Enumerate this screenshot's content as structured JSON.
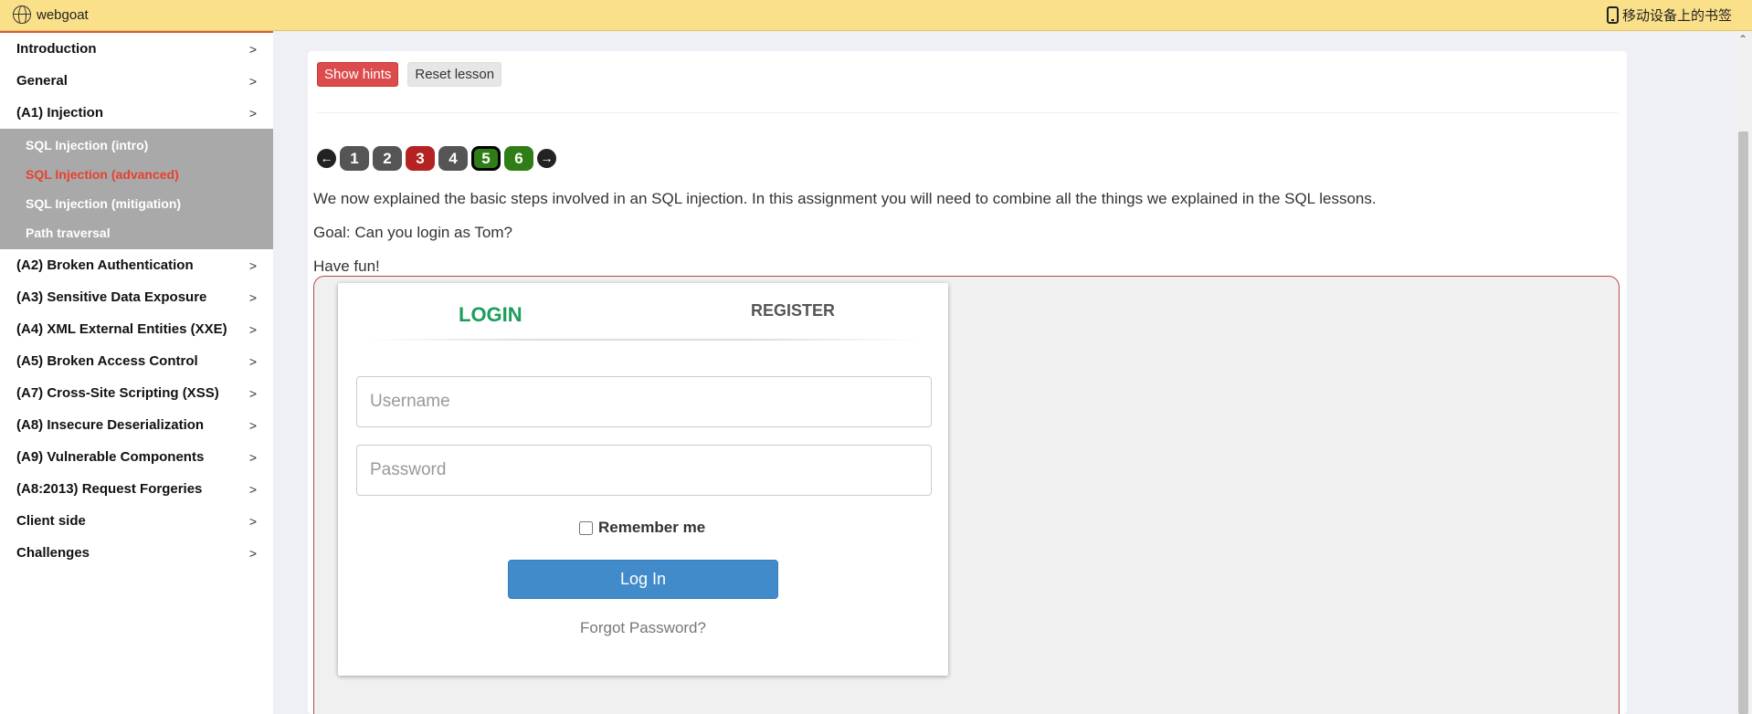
{
  "bookmark_bar": {
    "left_label": "webgoat",
    "right_label": "移动设备上的书签"
  },
  "sidebar": {
    "items": [
      {
        "label": "Introduction"
      },
      {
        "label": "General"
      },
      {
        "label": "(A1) Injection",
        "expanded": true,
        "subitems": [
          {
            "label": "SQL Injection (intro)"
          },
          {
            "label": "SQL Injection (advanced)",
            "active": true
          },
          {
            "label": "SQL Injection (mitigation)"
          },
          {
            "label": "Path traversal"
          }
        ]
      },
      {
        "label": "(A2) Broken Authentication"
      },
      {
        "label": "(A3) Sensitive Data Exposure"
      },
      {
        "label": "(A4) XML External Entities (XXE)"
      },
      {
        "label": "(A5) Broken Access Control"
      },
      {
        "label": "(A7) Cross-Site Scripting (XSS)"
      },
      {
        "label": "(A8) Insecure Deserialization"
      },
      {
        "label": "(A9) Vulnerable Components"
      },
      {
        "label": "(A8:2013) Request Forgeries"
      },
      {
        "label": "Client side"
      },
      {
        "label": "Challenges"
      }
    ],
    "chevron": ">"
  },
  "toolbar": {
    "show_hints": "Show hints",
    "reset_lesson": "Reset lesson"
  },
  "pager": {
    "prev_icon": "arrow-left-icon",
    "next_icon": "arrow-right-icon",
    "pages": [
      {
        "label": "1",
        "status": "grey"
      },
      {
        "label": "2",
        "status": "grey"
      },
      {
        "label": "3",
        "status": "red"
      },
      {
        "label": "4",
        "status": "grey"
      },
      {
        "label": "5",
        "status": "current"
      },
      {
        "label": "6",
        "status": "green"
      }
    ]
  },
  "lesson": {
    "paragraphs": [
      "We now explained the basic steps involved in an SQL injection. In this assignment you will need to combine all the things we explained in the SQL lessons.",
      "Goal: Can you login as Tom?",
      "Have fun!"
    ]
  },
  "login_form": {
    "tab_login": "LOGIN",
    "tab_register": "REGISTER",
    "username_placeholder": "Username",
    "password_placeholder": "Password",
    "remember_label": "Remember me",
    "login_button": "Log In",
    "forgot_link": "Forgot Password?"
  },
  "colors": {
    "bookmark_bar": "#fbe08a",
    "active_submenu": "#e8412f",
    "login_tab": "#1a9e5a",
    "login_button": "#428bca",
    "hints_button": "#dc4c4c"
  }
}
